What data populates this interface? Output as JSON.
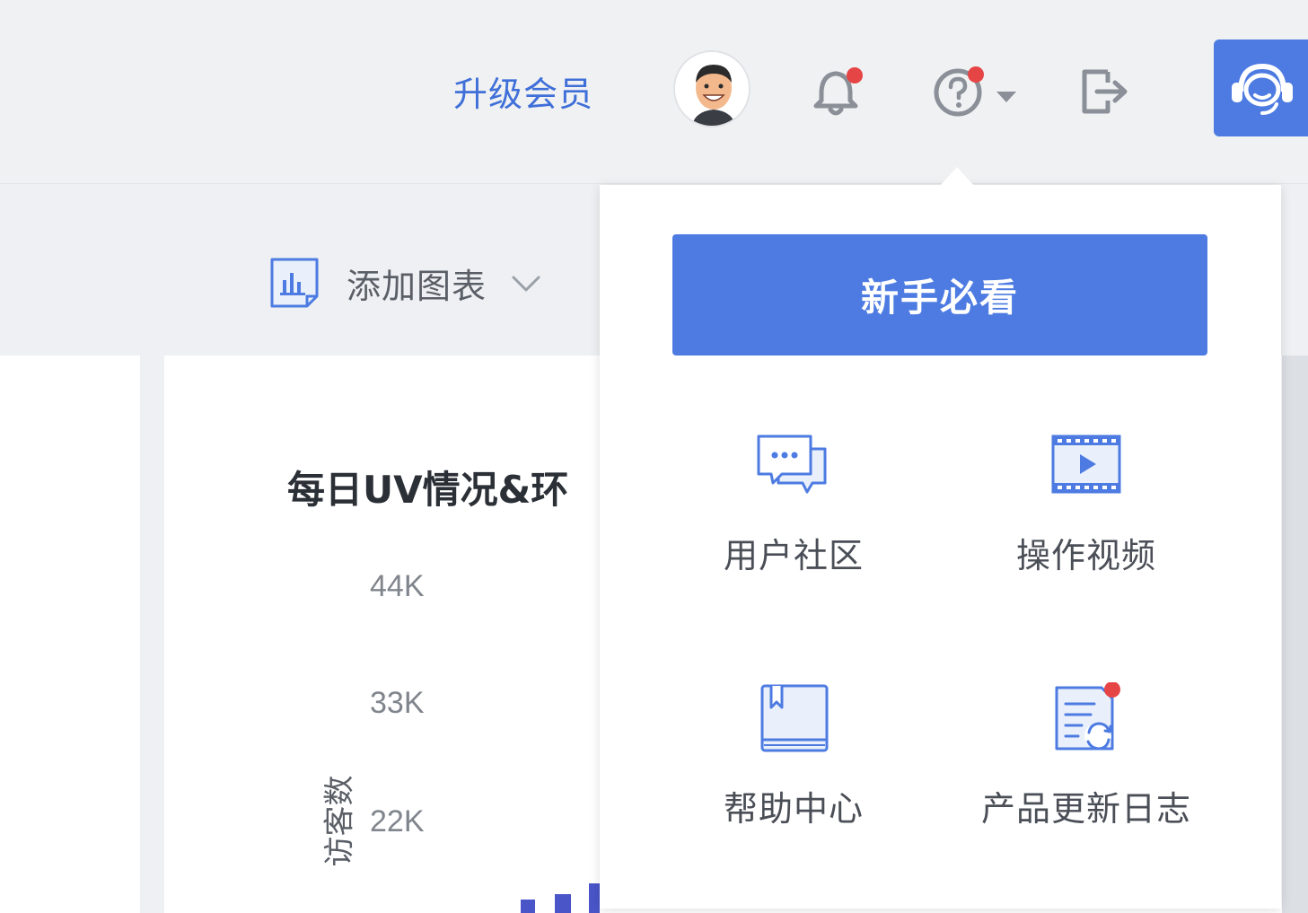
{
  "header": {
    "upgrade_label": "升级会员",
    "icons": [
      "avatar",
      "bell-icon",
      "help-icon",
      "logout-icon",
      "customer-service-icon"
    ],
    "accent_color": "#4d7be2",
    "notification_dot_color": "#e64545"
  },
  "toolbar": {
    "add_chart_label": "添加图表"
  },
  "chart_card": {
    "title": "每日UV情况&环",
    "ylabel": "访客数",
    "yticks": [
      "44K",
      "33K",
      "22K"
    ]
  },
  "dropdown": {
    "primary_button": "新手必看",
    "items": [
      {
        "label": "用户社区",
        "icon": "chat-bubbles-icon"
      },
      {
        "label": "操作视频",
        "icon": "video-icon"
      },
      {
        "label": "帮助中心",
        "icon": "book-icon"
      },
      {
        "label": "产品更新日志",
        "icon": "changelog-icon"
      }
    ]
  }
}
